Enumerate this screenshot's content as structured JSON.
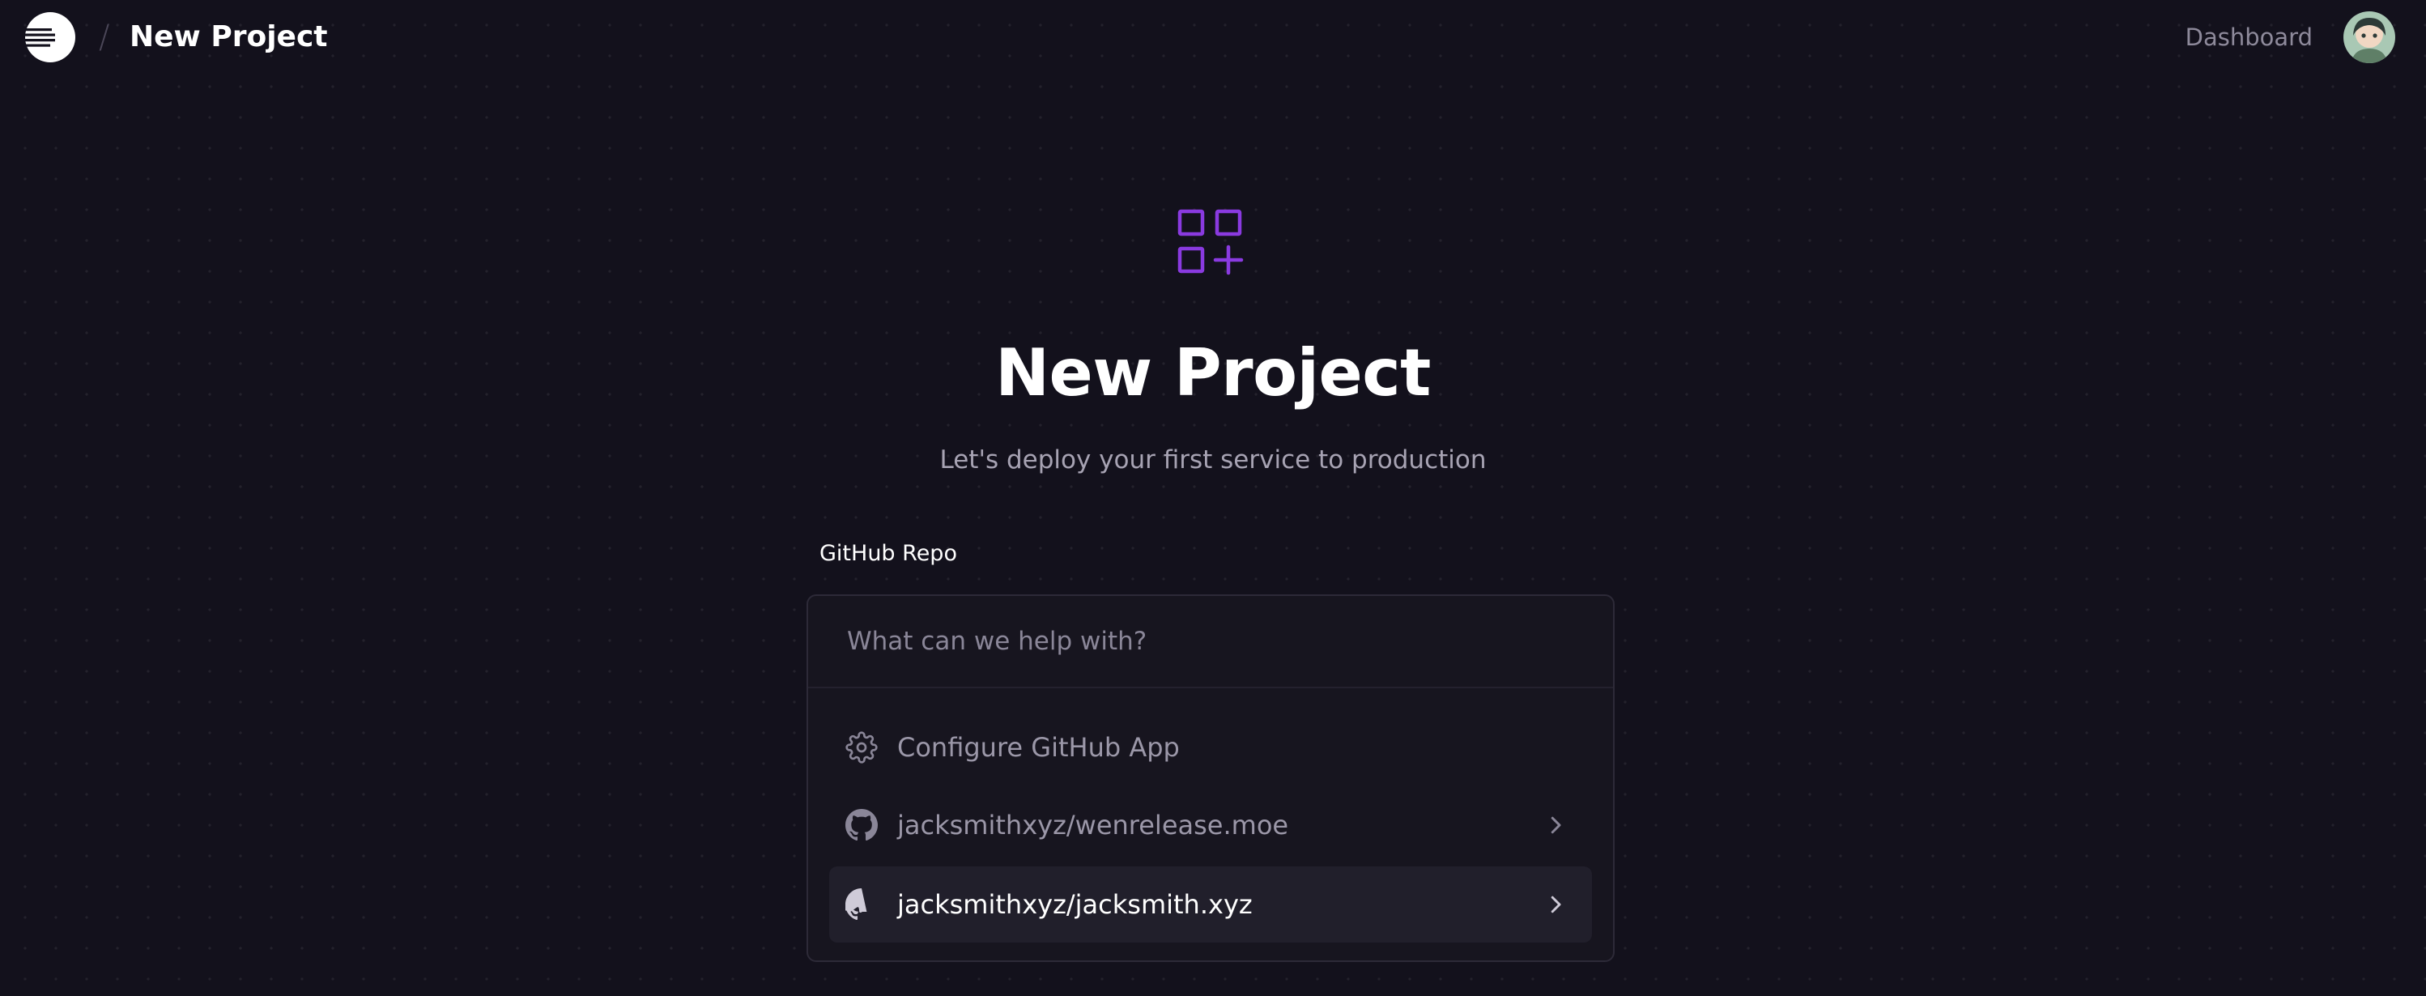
{
  "header": {
    "title": "New Project",
    "separator": "/",
    "nav_dashboard": "Dashboard"
  },
  "hero": {
    "title": "New Project",
    "subtitle": "Let's deploy your first service to production"
  },
  "repo_selector": {
    "label": "GitHub Repo",
    "search_placeholder": "What can we help with?",
    "items": [
      {
        "label": "Configure GitHub App",
        "icon": "gear-icon"
      },
      {
        "label": "jacksmithxyz/wenrelease.moe",
        "icon": "github-icon"
      },
      {
        "label": "jacksmithxyz/jacksmith.xyz",
        "icon": "github-icon",
        "selected": true
      }
    ]
  },
  "colors": {
    "background": "#13111c",
    "accent": "#8a3ae0",
    "panel_border": "#2d2a38",
    "muted_text": "#8e8a9b"
  }
}
